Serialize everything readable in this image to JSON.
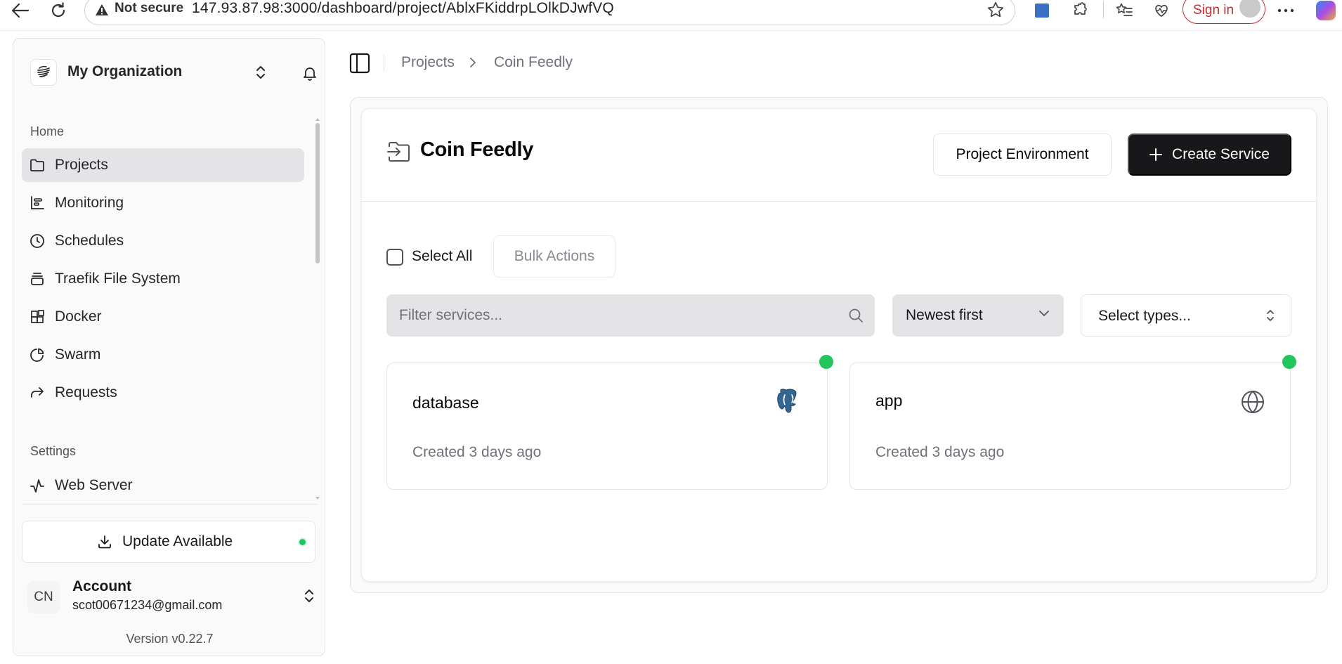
{
  "browser": {
    "not_secure": "Not secure",
    "url": "147.93.87.98:3000/dashboard/project/AblxFKiddrpLOlkDJwfVQ",
    "sign_in": "Sign in"
  },
  "sidebar": {
    "org_name": "My Organization",
    "home_label": "Home",
    "settings_label": "Settings",
    "items": [
      {
        "label": "Projects",
        "icon": "folder-icon",
        "active": true
      },
      {
        "label": "Monitoring",
        "icon": "chart-icon"
      },
      {
        "label": "Schedules",
        "icon": "clock-icon"
      },
      {
        "label": "Traefik File System",
        "icon": "layers-icon"
      },
      {
        "label": "Docker",
        "icon": "blocks-icon"
      },
      {
        "label": "Swarm",
        "icon": "pie-icon"
      },
      {
        "label": "Requests",
        "icon": "forward-arrow-icon"
      }
    ],
    "settings_items": [
      {
        "label": "Web Server",
        "icon": "activity-icon"
      }
    ],
    "update_label": "Update Available",
    "account": {
      "initials": "CN",
      "name": "Account",
      "email": "scot00671234@gmail.com"
    },
    "version": "Version v0.22.7"
  },
  "breadcrumb": {
    "projects": "Projects",
    "current": "Coin Feedly"
  },
  "project": {
    "title": "Coin Feedly",
    "env_button": "Project Environment",
    "create_button": "Create Service"
  },
  "toolbar": {
    "select_all": "Select All",
    "bulk_actions": "Bulk Actions",
    "filter_placeholder": "Filter services...",
    "sort_value": "Newest first",
    "types_placeholder": "Select types..."
  },
  "services": [
    {
      "name": "database",
      "created": "Created 3 days ago",
      "icon": "postgres-icon",
      "status_color": "#22c55e"
    },
    {
      "name": "app",
      "created": "Created 3 days ago",
      "icon": "globe-icon",
      "status_color": "#22c55e"
    }
  ],
  "colors": {
    "primary": "#18181b",
    "status_ok": "#22c55e",
    "sign_in": "#c62828"
  }
}
